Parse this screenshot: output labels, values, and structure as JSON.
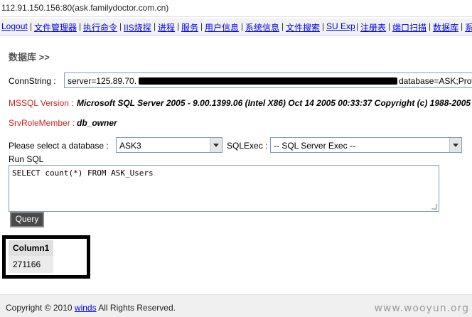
{
  "address_bar": {
    "url": "112.91.150.156:80(ask.familydoctor.com.cn)"
  },
  "nav": {
    "items": [
      "Logout",
      "文件管理器",
      "执行命令",
      "IIS烧探",
      "进程",
      "服务",
      "用户信息",
      "系统信息",
      "文件搜索",
      "SU Exp",
      "注册表",
      "端口扫描",
      "数据库",
      "系统"
    ],
    "separator": "|"
  },
  "page": {
    "title": "数据库 >>",
    "connstring_label": "ConnString :",
    "connstring_prefix": "server=125.89.70.",
    "connstring_suffix": "database=ASK;Prov",
    "mssql_label": "MSSQL Version :",
    "mssql_value": "Microsoft SQL Server 2005 - 9.00.1399.06 (Intel X86) Oct 14 2005 00:33:37 Copyright (c) 1988-2005",
    "role_label": "SrvRoleMember :",
    "role_value": "db_owner",
    "select_db_label": "Please select a database :",
    "db_selected": "ASK3",
    "sqlexec_label": "SQLExec :",
    "sqlexec_selected": "-- SQL Server Exec --",
    "run_sql_label": "Run SQL",
    "sql_text": "SELECT count(*) FROM ASK_Users",
    "query_button": "Query"
  },
  "result": {
    "columns": [
      "Column1"
    ],
    "rows": [
      [
        "271166"
      ]
    ]
  },
  "footer": {
    "copyright_pre": "Copyright © 2010",
    "link": "winds",
    "copyright_post": "All Rights Reserved."
  },
  "watermark": "www.wooyun.org",
  "colors": {
    "link": "#0000ee",
    "label_red": "#cc2222",
    "button_bg": "#4a4a4a"
  }
}
